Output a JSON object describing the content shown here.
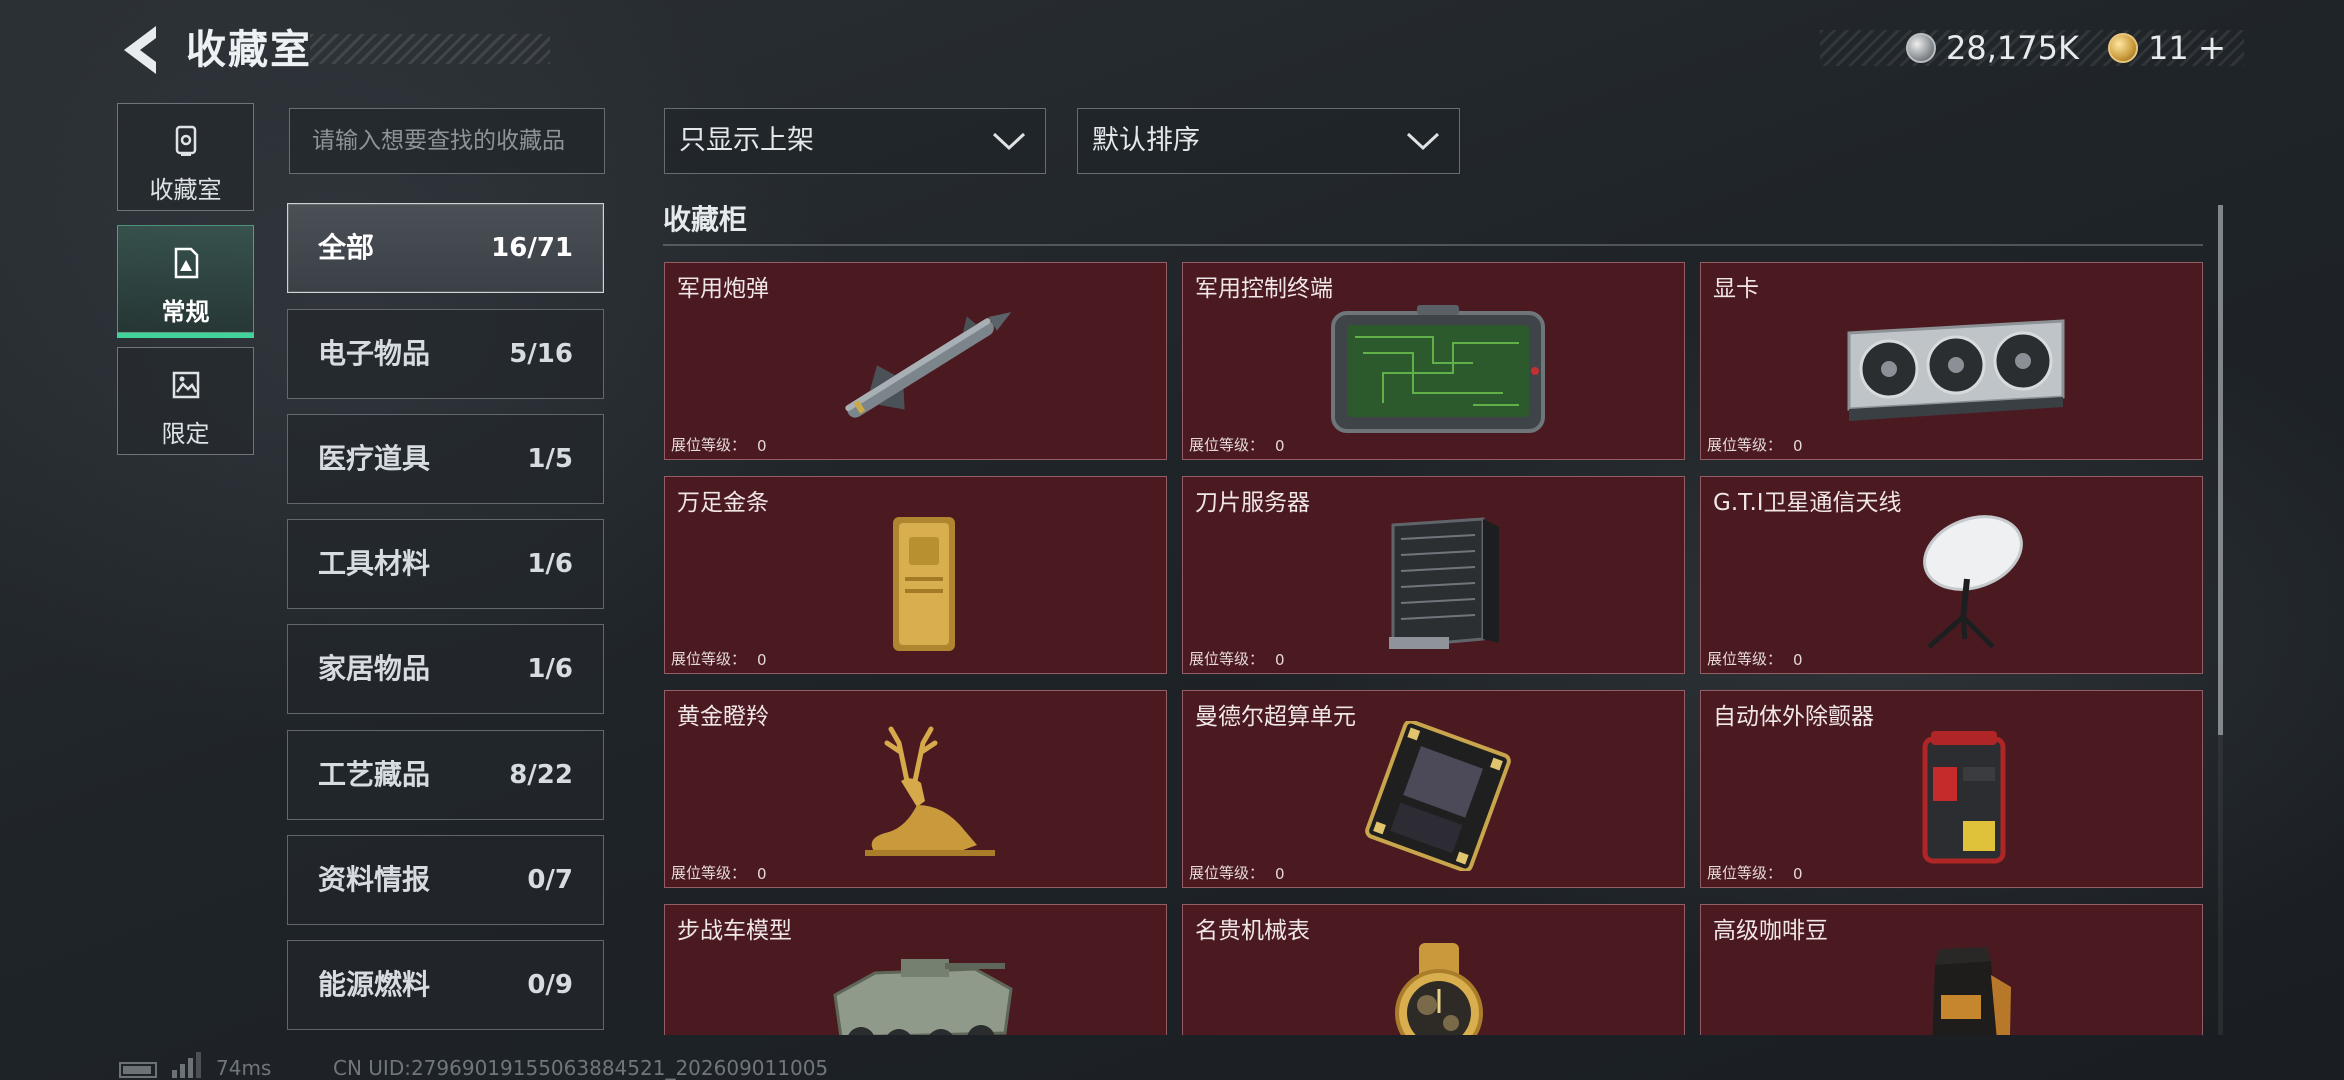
{
  "header": {
    "title": "收藏室",
    "coin_value": "28,175K",
    "token_value": "11"
  },
  "nav_tabs": [
    {
      "label": "收藏室",
      "icon": "collection-room-icon"
    },
    {
      "label": "常规",
      "icon": "regular-exhibit-icon"
    },
    {
      "label": "限定",
      "icon": "limited-exhibit-icon"
    }
  ],
  "search": {
    "placeholder": "请输入想要查找的收藏品",
    "value": ""
  },
  "filters": {
    "display": "只显示上架",
    "sort": "默认排序"
  },
  "categories": [
    {
      "name": "全部",
      "count": "16/71"
    },
    {
      "name": "电子物品",
      "count": "5/16"
    },
    {
      "name": "医疗道具",
      "count": "1/5"
    },
    {
      "name": "工具材料",
      "count": "1/6"
    },
    {
      "name": "家居物品",
      "count": "1/6"
    },
    {
      "name": "工艺藏品",
      "count": "8/22"
    },
    {
      "name": "资料情报",
      "count": "0/7"
    },
    {
      "name": "能源燃料",
      "count": "0/9"
    }
  ],
  "section_title": "收藏柜",
  "level_label": "展位等级：",
  "items": [
    {
      "name": "军用炮弹",
      "level": "0",
      "icon": "missile-icon"
    },
    {
      "name": "军用控制终端",
      "level": "0",
      "icon": "control-terminal-icon"
    },
    {
      "name": "显卡",
      "level": "0",
      "icon": "graphics-card-icon"
    },
    {
      "name": "万足金条",
      "level": "0",
      "icon": "gold-bar-icon"
    },
    {
      "name": "刀片服务器",
      "level": "0",
      "icon": "blade-server-icon"
    },
    {
      "name": "G.T.I卫星通信天线",
      "level": "0",
      "icon": "satellite-dish-icon"
    },
    {
      "name": "黄金瞪羚",
      "level": "0",
      "icon": "golden-gazelle-icon"
    },
    {
      "name": "曼德尔超算单元",
      "level": "0",
      "icon": "cpu-chip-icon"
    },
    {
      "name": "自动体外除颤器",
      "level": "0",
      "icon": "defibrillator-icon"
    },
    {
      "name": "步战车模型",
      "level": "",
      "icon": "ifv-model-icon"
    },
    {
      "name": "名贵机械表",
      "level": "",
      "icon": "mechanical-watch-icon"
    },
    {
      "name": "高级咖啡豆",
      "level": "",
      "icon": "coffee-bag-icon"
    }
  ],
  "footer": {
    "ping": "74ms",
    "uid": "CN UID:27969019155063884521_202609011005"
  },
  "colors": {
    "card_bg": "#4a1a20",
    "active_accent": "#41d39a"
  }
}
